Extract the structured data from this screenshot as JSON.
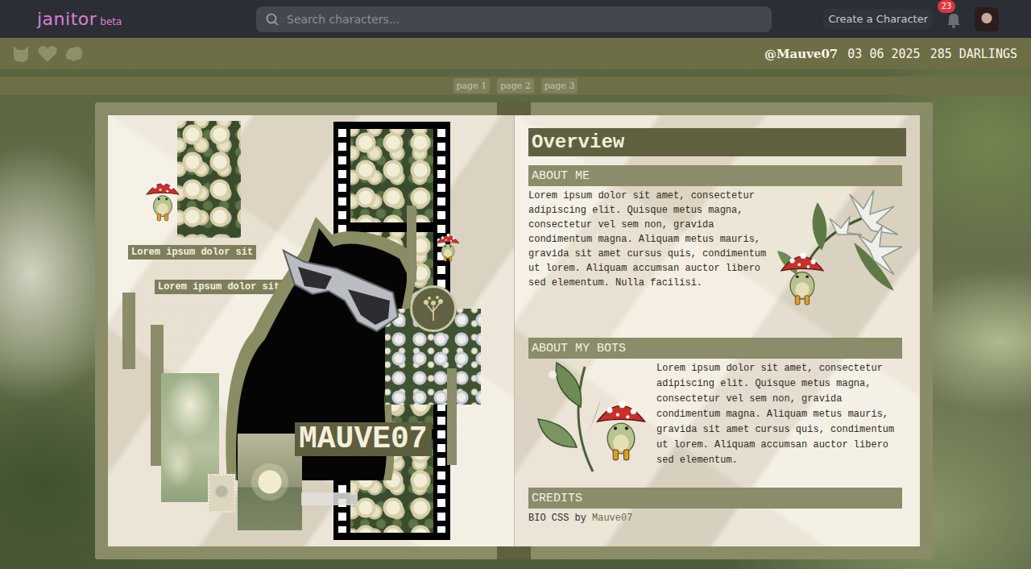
{
  "nav": {
    "logo": "janitor",
    "tag": "beta",
    "search": {
      "placeholder": "Search characters..."
    },
    "create_button": "Create a Character",
    "notifications": "23"
  },
  "profile": {
    "handle": "@Mauve07",
    "date": "03 06 2025",
    "followers": "285 DARLINGS"
  },
  "pagination": [
    "page 1",
    "page 2",
    "page 3"
  ],
  "left_page": {
    "labels": [
      "Lorem ipsum dolor sit",
      "Lorem ipsum dolor sit amet"
    ],
    "name": "MAUVE07"
  },
  "right_page": {
    "title": "Overview",
    "sections": [
      {
        "heading": "ABOUT ME",
        "body": "Lorem ipsum dolor sit amet, consectetur adipiscing elit. Quisque metus magna, consectetur vel sem non, gravida condimentum magna. Aliquam metus mauris, gravida sit amet cursus quis, condimentum ut lorem. Aliquam accumsan auctor libero sed elementum. Nulla facilisi."
      },
      {
        "heading": "ABOUT MY BOTS",
        "body": "Lorem ipsum dolor sit amet, consectetur adipiscing elit. Quisque metus magna, consectetur vel sem non, gravida condimentum magna. Aliquam metus mauris, gravida sit amet cursus quis, condimentum ut lorem. Aliquam accumsan auctor libero sed elementum."
      }
    ],
    "credits": {
      "heading": "CREDITS",
      "text": "BIO CSS by",
      "author": "Mauve07"
    }
  }
}
